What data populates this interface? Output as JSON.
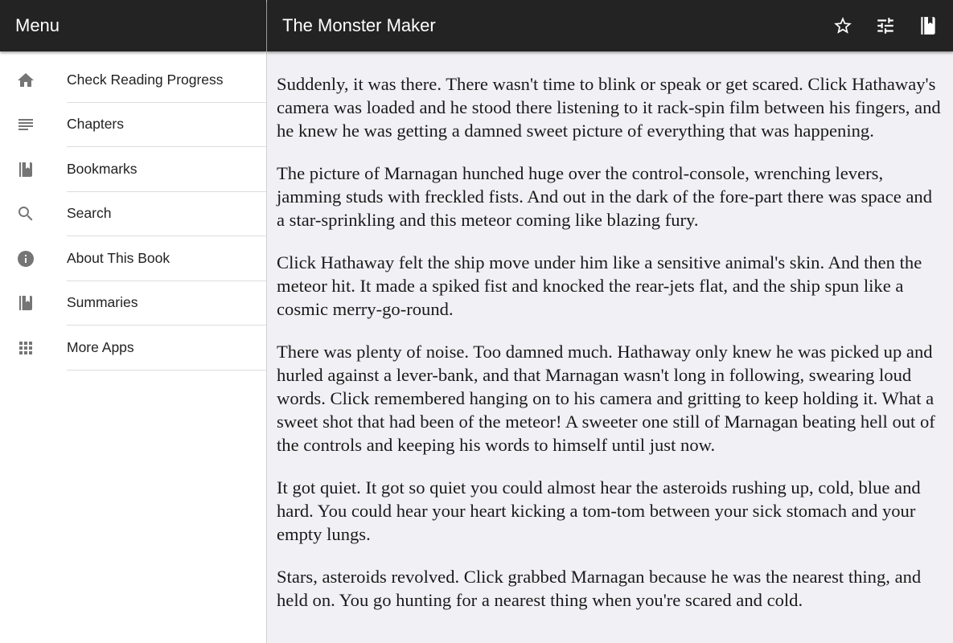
{
  "sidebar": {
    "title": "Menu",
    "items": [
      {
        "label": "Check Reading Progress",
        "icon": "home-icon"
      },
      {
        "label": "Chapters",
        "icon": "list-icon"
      },
      {
        "label": "Bookmarks",
        "icon": "book-icon"
      },
      {
        "label": "Search",
        "icon": "search-icon"
      },
      {
        "label": "About This Book",
        "icon": "info-icon"
      },
      {
        "label": "Summaries",
        "icon": "book-icon"
      },
      {
        "label": "More Apps",
        "icon": "apps-grid-icon"
      }
    ]
  },
  "header": {
    "title": "The Monster Maker",
    "actions": [
      "star-icon",
      "settings-sliders-icon",
      "book-icon"
    ]
  },
  "content": {
    "paragraphs": [
      "Suddenly, it was there. There wasn't time to blink or speak or get scared. Click Hathaway's camera was loaded and he stood there listening to it rack-spin film between his fingers, and he knew he was getting a damned sweet picture of everything that was happening.",
      "The picture of Marnagan hunched huge over the control-console, wrenching levers, jamming studs with freckled fists. And out in the dark of the fore-part there was space and a star-sprinkling and this meteor coming like blazing fury.",
      "Click Hathaway felt the ship move under him like a sensitive animal's skin. And then the meteor hit. It made a spiked fist and knocked the rear-jets flat, and the ship spun like a cosmic merry-go-round.",
      "There was plenty of noise. Too damned much. Hathaway only knew he was picked up and hurled against a lever-bank, and that Marnagan wasn't long in following, swearing loud words. Click remembered hanging on to his camera and gritting to keep holding it. What a sweet shot that had been of the meteor! A sweeter one still of Marnagan beating hell out of the controls and keeping his words to himself until just now.",
      "It got quiet. It got so quiet you could almost hear the asteroids rushing up, cold, blue and hard. You could hear your heart kicking a tom-tom between your sick stomach and your empty lungs.",
      "Stars, asteroids revolved. Click grabbed Marnagan because he was the nearest thing, and held on. You go hunting for a nearest thing when you're scared and cold."
    ]
  },
  "colors": {
    "bar_bg": "#232323",
    "content_bg": "#f1f1f5",
    "icon_gray": "#757575"
  }
}
